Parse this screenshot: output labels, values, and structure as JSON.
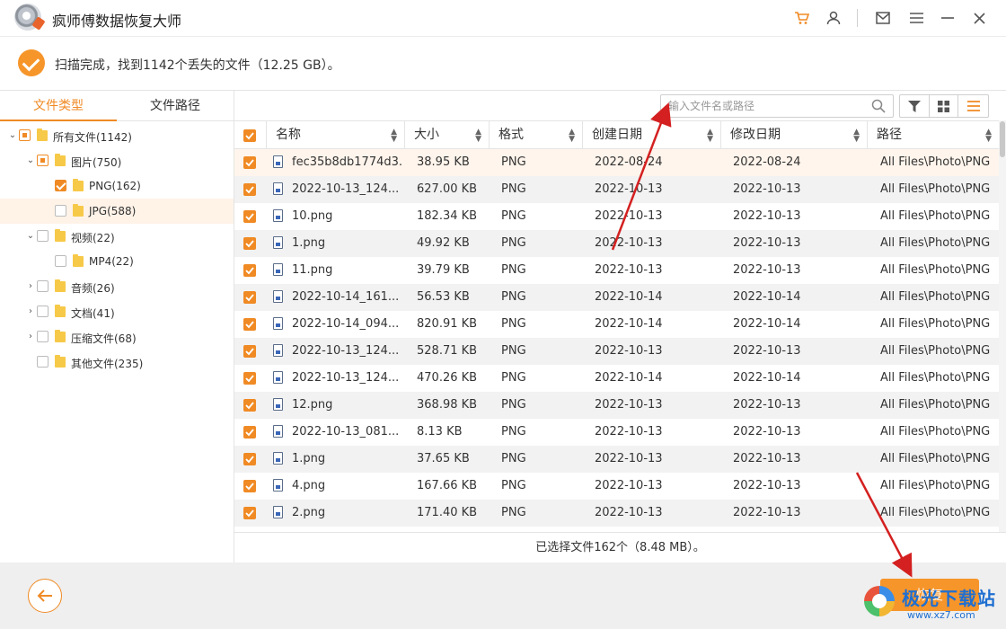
{
  "app": {
    "title": "疯师傅数据恢复大师"
  },
  "status": {
    "text": "扫描完成，找到1142个丢失的文件（12.25 GB）。"
  },
  "sidebar": {
    "tabs": [
      {
        "label": "文件类型",
        "active": true
      },
      {
        "label": "文件路径",
        "active": false
      }
    ],
    "tree": [
      {
        "label": "所有文件(1142)",
        "level": 0,
        "expanded": true,
        "check": "partial",
        "selected": false
      },
      {
        "label": "图片(750)",
        "level": 1,
        "expanded": true,
        "check": "partial",
        "selected": false
      },
      {
        "label": "PNG(162)",
        "level": 2,
        "expanded": null,
        "check": "checked",
        "selected": false
      },
      {
        "label": "JPG(588)",
        "level": 2,
        "expanded": null,
        "check": "unchecked",
        "selected": true
      },
      {
        "label": "视频(22)",
        "level": 1,
        "expanded": true,
        "check": "unchecked",
        "selected": false
      },
      {
        "label": "MP4(22)",
        "level": 2,
        "expanded": null,
        "check": "unchecked",
        "selected": false
      },
      {
        "label": "音频(26)",
        "level": 1,
        "expanded": false,
        "check": "unchecked",
        "selected": false
      },
      {
        "label": "文档(41)",
        "level": 1,
        "expanded": false,
        "check": "unchecked",
        "selected": false
      },
      {
        "label": "压缩文件(68)",
        "level": 1,
        "expanded": false,
        "check": "unchecked",
        "selected": false
      },
      {
        "label": "其他文件(235)",
        "level": 1,
        "expanded": null,
        "check": "unchecked",
        "selected": false
      }
    ]
  },
  "search": {
    "placeholder": "输入文件名或路径",
    "value": ""
  },
  "table": {
    "columns": [
      "名称",
      "大小",
      "格式",
      "创建日期",
      "修改日期",
      "路径"
    ],
    "rows": [
      {
        "name": "fec35b8db1774d3...",
        "size": "38.95 KB",
        "format": "PNG",
        "created": "2022-08-24",
        "modified": "2022-08-24",
        "path": "All Files\\Photo\\PNG"
      },
      {
        "name": "2022-10-13_124...",
        "size": "627.00 KB",
        "format": "PNG",
        "created": "2022-10-13",
        "modified": "2022-10-13",
        "path": "All Files\\Photo\\PNG"
      },
      {
        "name": "10.png",
        "size": "182.34 KB",
        "format": "PNG",
        "created": "2022-10-13",
        "modified": "2022-10-13",
        "path": "All Files\\Photo\\PNG"
      },
      {
        "name": "1.png",
        "size": "49.92 KB",
        "format": "PNG",
        "created": "2022-10-13",
        "modified": "2022-10-13",
        "path": "All Files\\Photo\\PNG"
      },
      {
        "name": "11.png",
        "size": "39.79 KB",
        "format": "PNG",
        "created": "2022-10-13",
        "modified": "2022-10-13",
        "path": "All Files\\Photo\\PNG"
      },
      {
        "name": "2022-10-14_161...",
        "size": "56.53 KB",
        "format": "PNG",
        "created": "2022-10-14",
        "modified": "2022-10-14",
        "path": "All Files\\Photo\\PNG"
      },
      {
        "name": "2022-10-14_094...",
        "size": "820.91 KB",
        "format": "PNG",
        "created": "2022-10-14",
        "modified": "2022-10-14",
        "path": "All Files\\Photo\\PNG"
      },
      {
        "name": "2022-10-13_124...",
        "size": "528.71 KB",
        "format": "PNG",
        "created": "2022-10-13",
        "modified": "2022-10-13",
        "path": "All Files\\Photo\\PNG"
      },
      {
        "name": "2022-10-13_124...",
        "size": "470.26 KB",
        "format": "PNG",
        "created": "2022-10-14",
        "modified": "2022-10-14",
        "path": "All Files\\Photo\\PNG"
      },
      {
        "name": "12.png",
        "size": "368.98 KB",
        "format": "PNG",
        "created": "2022-10-13",
        "modified": "2022-10-13",
        "path": "All Files\\Photo\\PNG"
      },
      {
        "name": "2022-10-13_081...",
        "size": "8.13 KB",
        "format": "PNG",
        "created": "2022-10-13",
        "modified": "2022-10-13",
        "path": "All Files\\Photo\\PNG"
      },
      {
        "name": "1.png",
        "size": "37.65 KB",
        "format": "PNG",
        "created": "2022-10-13",
        "modified": "2022-10-13",
        "path": "All Files\\Photo\\PNG"
      },
      {
        "name": "4.png",
        "size": "167.66 KB",
        "format": "PNG",
        "created": "2022-10-13",
        "modified": "2022-10-13",
        "path": "All Files\\Photo\\PNG"
      },
      {
        "name": "2.png",
        "size": "171.40 KB",
        "format": "PNG",
        "created": "2022-10-13",
        "modified": "2022-10-13",
        "path": "All Files\\Photo\\PNG"
      }
    ]
  },
  "selection": {
    "text": "已选择文件162个（8.48 MB）。"
  },
  "footer": {
    "recover_label": "恢复"
  },
  "watermark": {
    "text": "极光下载站",
    "url": "www.xz7.com"
  },
  "colors": {
    "accent": "#f08a24",
    "annotation": "#d42020"
  }
}
